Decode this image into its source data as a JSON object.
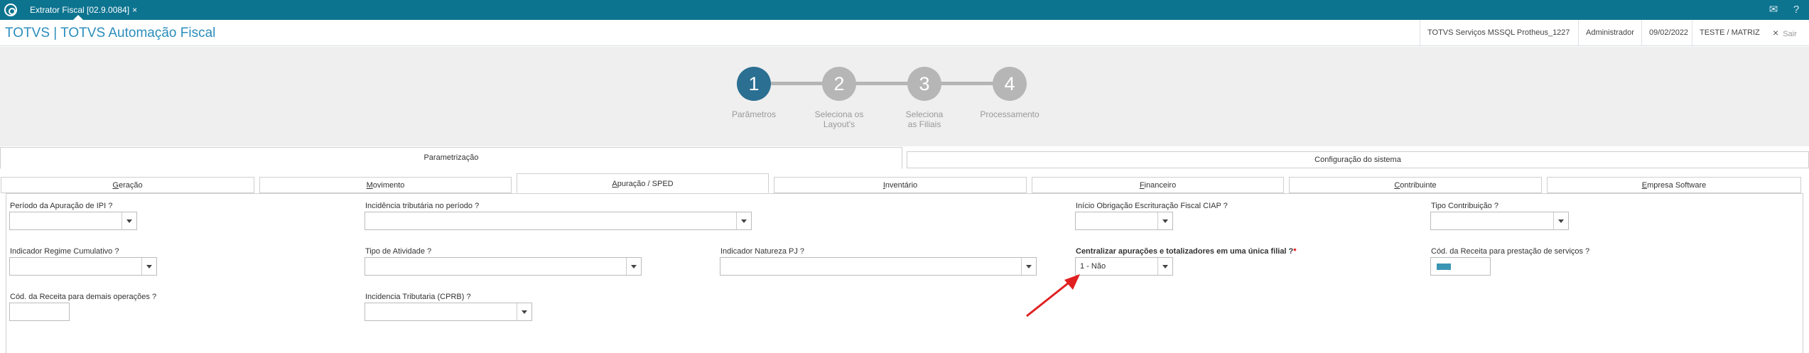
{
  "top_tab": {
    "title": "Extrator Fiscal [02.9.0084]",
    "close": "×"
  },
  "top_icons": {
    "mail": "mail-icon",
    "help": "help-icon"
  },
  "header": {
    "title": "TOTVS | TOTVS Automação Fiscal",
    "environment": "TOTVS Serviços MSSQL Protheus_1227",
    "user": "Administrador",
    "date": "09/02/2022",
    "branch": "TESTE / MATRIZ",
    "exit": "Sair",
    "exit_icon": "×"
  },
  "steps": [
    {
      "number": "1",
      "label": "Parâmetros",
      "active": true
    },
    {
      "number": "2",
      "label": "Seleciona os Layout's",
      "active": false
    },
    {
      "number": "3",
      "label": "Seleciona as Filiais",
      "active": false
    },
    {
      "number": "4",
      "label": "Processamento",
      "active": false
    }
  ],
  "main_tabs": [
    "Parametrização",
    "Configuração do sistema"
  ],
  "sub_tabs": [
    {
      "first": "G",
      "rest": "eração"
    },
    {
      "first": "M",
      "rest": "ovimento"
    },
    {
      "first": "A",
      "rest": "puração / SPED"
    },
    {
      "first": "I",
      "rest": "nventário"
    },
    {
      "first": "F",
      "rest": "inanceiro"
    },
    {
      "first": "C",
      "rest": "ontribuinte"
    },
    {
      "first": "E",
      "rest": "mpresa Software"
    }
  ],
  "fields": {
    "periodo_ipi": {
      "label": "Período da Apuração de IPI ?",
      "value": ""
    },
    "incidencia": {
      "label": "Incidência tributária no período ?",
      "value": ""
    },
    "inicio_ciap": {
      "label": "Início Obrigação Escrituração Fiscal CIAP ?",
      "value": ""
    },
    "tipo_contribuicao": {
      "label": "Tipo Contribuição ?",
      "value": ""
    },
    "regime_cumulativo": {
      "label": "Indicador Regime Cumulativo ?",
      "value": ""
    },
    "tipo_atividade": {
      "label": "Tipo de Atividade ?",
      "value": ""
    },
    "natureza_pj": {
      "label": "Indicador Natureza PJ ?",
      "value": ""
    },
    "centralizar": {
      "label": "Centralizar apurações e totalizadores em uma única filial ?",
      "required_mark": "*",
      "value": "1 - Não"
    },
    "cod_receita_servicos": {
      "label": "Cód. da Receita para prestação de serviços ?",
      "value": ""
    },
    "cod_receita_demais": {
      "label": "Cód. da Receita para demais operações ?",
      "value": ""
    },
    "cprb": {
      "label": "Incidencia Tributaria (CPRB) ?",
      "value": ""
    }
  },
  "colors": {
    "topbar": "#0d7490",
    "title": "#2b8dbb",
    "step_active": "#2b6f92",
    "step_inactive": "#b6b6b6",
    "arrow": "#e02020"
  }
}
